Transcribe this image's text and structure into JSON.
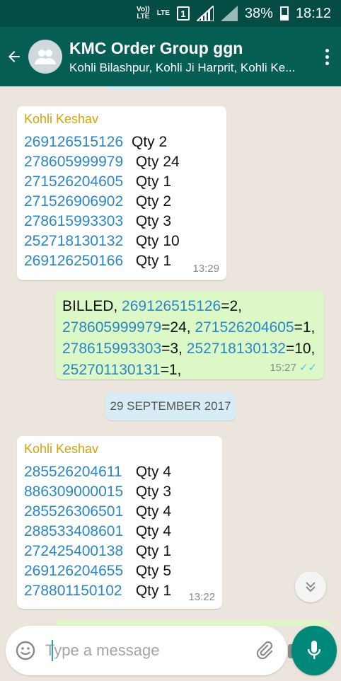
{
  "statusbar": {
    "volte": "Vo)) LTE",
    "lte": "LTE",
    "sim": "1",
    "battery": "38%",
    "time": "18:12"
  },
  "header": {
    "title": "KMC Order Group ggn",
    "subtitle": "Kohli Bilashpur, Kohli Ji Harprit, Kohli Ke..."
  },
  "messages": {
    "m1": {
      "sender": "Kohli Keshav",
      "rows": [
        {
          "code": "269126515126",
          "qty": "Qty  2"
        },
        {
          "code": "278605999979",
          "qty": " Qty 24"
        },
        {
          "code": "271526204605",
          "qty": " Qty  1"
        },
        {
          "code": "271526906902",
          "qty": " Qty  2"
        },
        {
          "code": "278615993303",
          "qty": " Qty  3"
        },
        {
          "code": "252718130132",
          "qty": " Qty 10"
        },
        {
          "code": "269126250166",
          "qty": " Qty  1"
        }
      ],
      "time": "13:29"
    },
    "m2": {
      "prefix": "BILLED, ",
      "items": [
        {
          "code": "269126515126",
          "val": "=2,"
        },
        {
          "code": "278605999979",
          "val": "=24, "
        },
        {
          "code": "271526204605",
          "val": "=1,"
        },
        {
          "code": "278615993303",
          "val": "=3, "
        },
        {
          "code": "252718130132",
          "val": "=10,"
        },
        {
          "code": "252701130131",
          "val": "=1,"
        }
      ],
      "time": "15:27",
      "ticks": "✓✓"
    },
    "date_divider": "29 SEPTEMBER 2017",
    "m3": {
      "sender": "Kohli Keshav",
      "rows": [
        {
          "code": "285526204611",
          "qty": " Qty  4"
        },
        {
          "code": "886309000015",
          "qty": " Qty  3"
        },
        {
          "code": "285526306501",
          "qty": " Qty  4"
        },
        {
          "code": "288533408601",
          "qty": " Qty  4"
        },
        {
          "code": "272425400138",
          "qty": " Qty   1"
        },
        {
          "code": "269126204655",
          "qty": " Qty  5"
        },
        {
          "code": "278801150102",
          "qty": " Qty  1"
        }
      ],
      "time": "13:22"
    }
  },
  "input": {
    "placeholder": "Type a message"
  },
  "colors": {
    "header": "#075e54",
    "statusbar": "#054d44",
    "link": "#2a87c6",
    "sender": "#d4a20a",
    "outgoing_bubble": "#dcf8c6",
    "mic_button": "#00897b"
  }
}
